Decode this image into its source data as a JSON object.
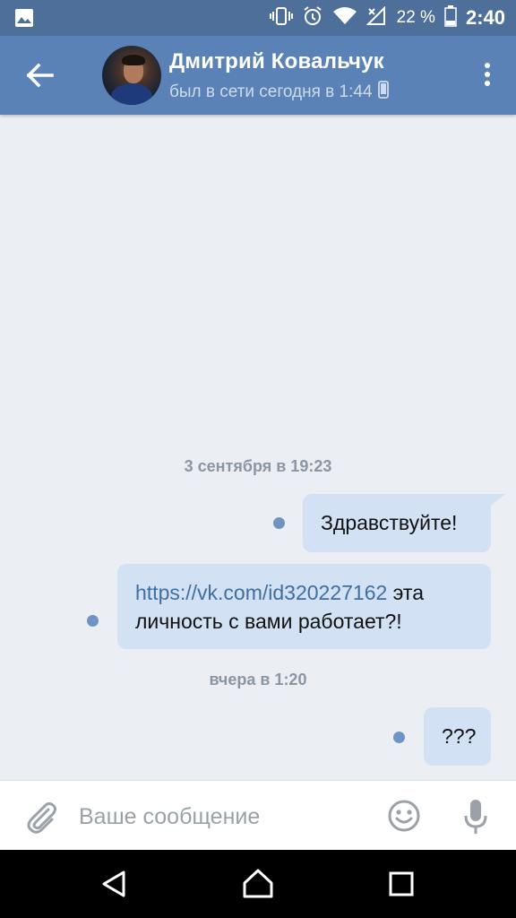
{
  "status_bar": {
    "battery_percent": "22 %",
    "time": "2:40",
    "icons": [
      "image-icon",
      "vibrate-icon",
      "alarm-icon",
      "wifi-icon",
      "signal-icon",
      "battery-icon"
    ]
  },
  "header": {
    "contact_name": "Дмитрий Ковальчук",
    "last_seen": "был в сети сегодня в 1:44",
    "device_icon": "mobile-icon"
  },
  "chat": {
    "separators": [
      {
        "label": "3 сентября в 19:23"
      },
      {
        "label": "вчера в 1:20"
      }
    ],
    "messages": [
      {
        "text": "Здравствуйте!"
      },
      {
        "link": "https://vk.com/id320227162",
        "text_line1_rest": " эта",
        "text_line2": "личность с вами работает?!"
      },
      {
        "text": "???"
      }
    ]
  },
  "composer": {
    "placeholder": "Ваше сообщение"
  },
  "colors": {
    "header_bg": "#5b82b6",
    "status_bg": "#4e6f99",
    "chat_bg": "#ebeef2",
    "bubble_bg": "#d2e1f3",
    "unread_dot": "#6e94c4",
    "link": "#3f6ea3"
  }
}
